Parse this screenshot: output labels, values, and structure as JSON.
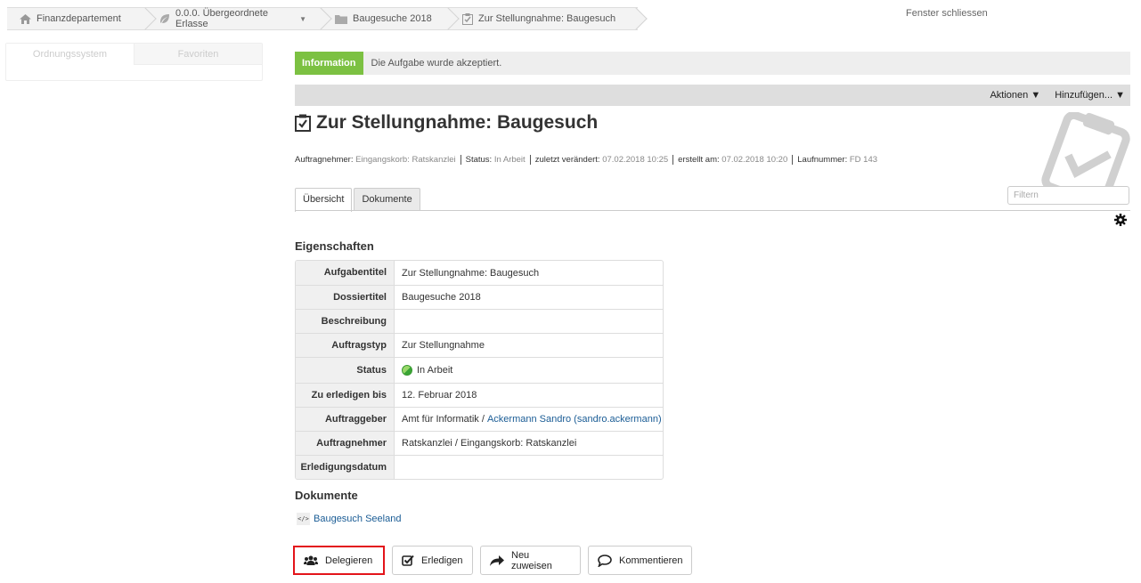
{
  "breadcrumb": [
    {
      "label": "Finanzdepartement",
      "icon": "home-icon"
    },
    {
      "label": "0.0.0. Übergeordnete Erlasse",
      "icon": "leaf-icon"
    },
    {
      "label": "Baugesuche 2018",
      "icon": "folder-icon"
    },
    {
      "label": "Zur Stellungnahme: Baugesuch",
      "icon": "task-icon"
    }
  ],
  "close_window": "Fenster schliessen",
  "left_tabs": [
    "Ordnungssystem",
    "Favoriten"
  ],
  "info": {
    "label": "Information",
    "message": "Die Aufgabe wurde akzeptiert."
  },
  "actions": {
    "aktionen": "Aktionen ▼",
    "hinzufuegen": "Hinzufügen... ▼"
  },
  "title": "Zur Stellungnahme: Baugesuch",
  "meta": {
    "auftragnehmer_label": "Auftragnehmer:",
    "auftragnehmer_value": "Eingangskorb: Ratskanzlei",
    "status_label": "Status:",
    "status_value": "In Arbeit",
    "modified_label": "zuletzt verändert:",
    "modified_value": "07.02.2018 10:25",
    "created_label": "erstellt am:",
    "created_value": "07.02.2018 10:20",
    "number_label": "Laufnummer:",
    "number_value": "FD 143"
  },
  "tabs": [
    "Übersicht",
    "Dokumente"
  ],
  "filter_placeholder": "Filtern",
  "properties_title": "Eigenschaften",
  "properties": [
    {
      "key": "Aufgabentitel",
      "value": "Zur Stellungnahme: Baugesuch"
    },
    {
      "key": "Dossiertitel",
      "value": "Baugesuche 2018"
    },
    {
      "key": "Beschreibung",
      "value": ""
    },
    {
      "key": "Auftragstyp",
      "value": "Zur Stellungnahme"
    },
    {
      "key": "Status",
      "value": "In Arbeit"
    },
    {
      "key": "Zu erledigen bis",
      "value": "12. Februar 2018"
    },
    {
      "key": "Auftraggeber",
      "value_prefix": "Amt für Informatik / ",
      "value_link": "Ackermann Sandro (sandro.ackermann)"
    },
    {
      "key": "Auftragnehmer",
      "value": "Ratskanzlei / Eingangskorb: Ratskanzlei"
    },
    {
      "key": "Erledigungsdatum",
      "value": ""
    }
  ],
  "documents_title": "Dokumente",
  "documents": [
    {
      "label": "Baugesuch Seeland",
      "icon_text": "</>"
    }
  ],
  "buttons": {
    "delegate": "Delegieren",
    "complete": "Erledigen",
    "reassign": "Neu zuweisen",
    "comment": "Kommentieren"
  }
}
